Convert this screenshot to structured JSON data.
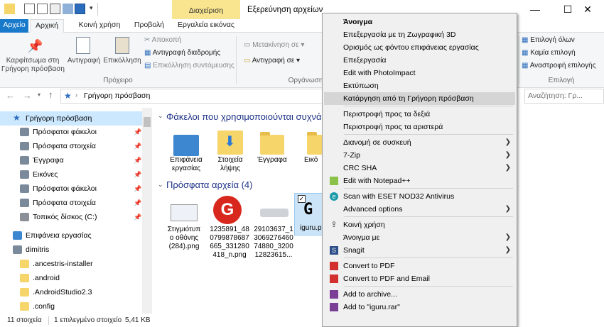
{
  "title": {
    "manage_tab": "Διαχείριση",
    "window_title": "Εξερεύνηση αρχείων"
  },
  "tabs": [
    "Αρχείο",
    "Αρχική",
    "Κοινή χρήση",
    "Προβολή",
    "Εργαλεία εικόνας"
  ],
  "ribbon": {
    "pin": "Καρφίτσωμα στη\nΓρήγορη πρόσβαση",
    "copy": "Αντιγραφή",
    "paste": "Επικόλληση",
    "cut": "Αποκοπή",
    "copy_path": "Αντιγραφή διαδρομής",
    "paste_shortcut": "Επικόλληση συντόμευσης",
    "clipboard_group": "Πρόχειρο",
    "move_to": "Μετακίνηση σε",
    "copy_to": "Αντιγραφή σε",
    "organize_group": "Οργάνωση",
    "select_all": "Επιλογή όλων",
    "select_none": "Καμία επιλογή",
    "invert_selection": "Αναστροφή επιλογής",
    "select_group": "Επιλογή"
  },
  "address": {
    "path": "Γρήγορη πρόσβαση",
    "search_placeholder": "Αναζήτηση: Γρ..."
  },
  "nav": [
    {
      "label": "Γρήγορη πρόσβαση",
      "icon": "star-icon",
      "pinned": false
    },
    {
      "label": "Πρόσφατοι φάκελοι",
      "icon": "recent-folders-icon",
      "pinned": true
    },
    {
      "label": "Πρόσφατα στοιχεία",
      "icon": "recent-items-icon",
      "pinned": true
    },
    {
      "label": "Έγγραφα",
      "icon": "documents-icon",
      "pinned": true
    },
    {
      "label": "Εικόνες",
      "icon": "pictures-icon",
      "pinned": true
    },
    {
      "label": "Πρόσφατοι φάκελοι",
      "icon": "recent-folders-icon",
      "pinned": true
    },
    {
      "label": "Πρόσφατα στοιχεία",
      "icon": "recent-items-icon",
      "pinned": true
    },
    {
      "label": "Τοπικός δίσκος (C:)",
      "icon": "drive-icon",
      "pinned": true
    },
    {
      "label": "Επιφάνεια εργασίας",
      "icon": "desktop-icon",
      "pinned": false
    },
    {
      "label": "dimitris",
      "icon": "user-icon",
      "pinned": false
    },
    {
      "label": ".ancestris-installer",
      "icon": "folder-icon",
      "pinned": false
    },
    {
      "label": ".android",
      "icon": "folder-icon",
      "pinned": false
    },
    {
      "label": ".AndroidStudio2.3",
      "icon": "folder-icon",
      "pinned": false
    },
    {
      "label": ".config",
      "icon": "folder-icon",
      "pinned": false
    }
  ],
  "content": {
    "frequent_header": "Φάκελοι που χρησιμοποιούνται συχνά",
    "recent_header": "Πρόσφατα αρχεία (4)",
    "folders": [
      "Επιφάνεια\nεργασίας",
      "Στοιχεία\nλήψης",
      "Έγγραφα",
      "Εικό"
    ],
    "files": [
      "Στιγμιότυπ\nο οθόνης\n(284).png",
      "1235891_48\n0799878687\n665_331280\n418_n.png",
      "29103637_1\n3069276460\n74880_3200\n12823615...",
      "iguru.p"
    ]
  },
  "status": {
    "count": "11 στοιχεία",
    "selected": "1 επιλεγμένο στοιχείο",
    "size": "5,41 KB"
  },
  "context_menu": [
    {
      "label": "Άνοιγμα",
      "bold": true
    },
    {
      "label": "Επεξεργασία με τη Ζωγραφική 3D"
    },
    {
      "label": "Ορισμός ως φόντου επιφάνειας εργασίας"
    },
    {
      "label": "Επεξεργασία"
    },
    {
      "label": "Edit with PhotoImpact"
    },
    {
      "label": "Εκτύπωση"
    },
    {
      "label": "Κατάργηση από τη Γρήγορη πρόσβαση",
      "highlighted": true
    },
    {
      "sep": true
    },
    {
      "label": "Περιστροφή προς τα δεξιά"
    },
    {
      "label": "Περιστροφή προς τα αριστερά"
    },
    {
      "sep": true
    },
    {
      "label": "Διανομή σε συσκευή",
      "submenu": true
    },
    {
      "label": "7-Zip",
      "submenu": true
    },
    {
      "label": "CRC SHA",
      "submenu": true
    },
    {
      "label": "Edit with Notepad++",
      "icon": "notepadpp-icon"
    },
    {
      "sep": true
    },
    {
      "label": "Scan with ESET NOD32 Antivirus",
      "icon": "eset-icon"
    },
    {
      "label": "Advanced options",
      "submenu": true
    },
    {
      "sep": true
    },
    {
      "label": "Κοινή χρήση",
      "icon": "share-icon"
    },
    {
      "label": "Άνοιγμα με",
      "submenu": true
    },
    {
      "label": "Snagit",
      "icon": "snagit-icon",
      "submenu": true
    },
    {
      "sep": true
    },
    {
      "label": "Convert to PDF",
      "icon": "pdf-icon"
    },
    {
      "label": "Convert to PDF and Email",
      "icon": "pdf-icon"
    },
    {
      "sep": true
    },
    {
      "label": "Add to archive...",
      "icon": "winrar-icon"
    },
    {
      "label": "Add to \"iguru.rar\"",
      "icon": "winrar-icon"
    }
  ],
  "colors": {
    "accent": "#1979ca",
    "manage": "#f9e58f",
    "folder": "#f6d56a",
    "highlight": "#d5d5d5"
  }
}
